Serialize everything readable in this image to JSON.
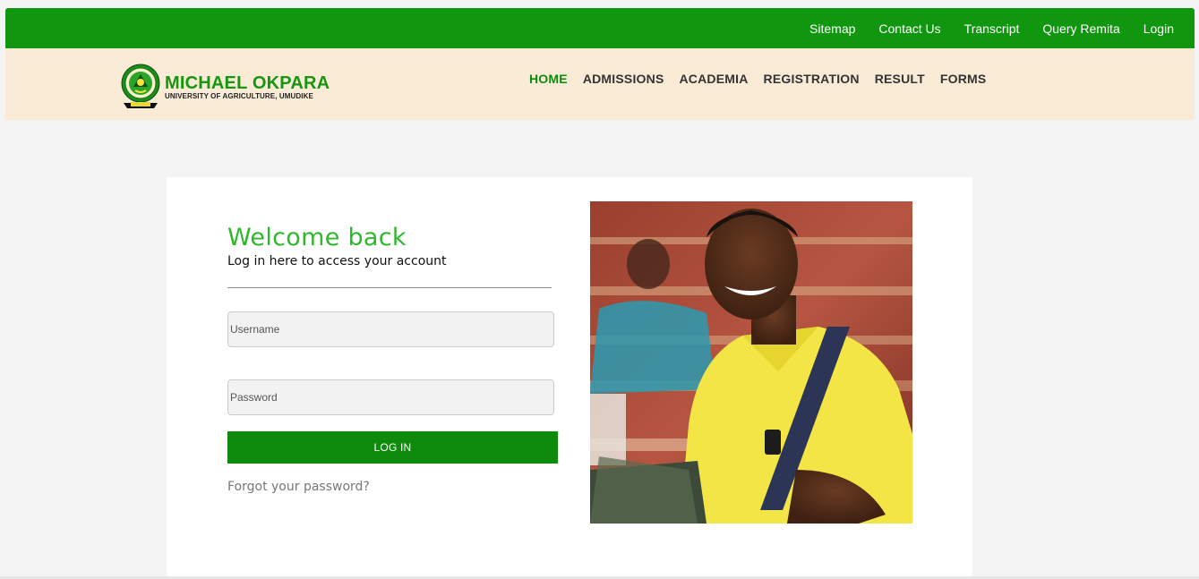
{
  "top_links": [
    "Sitemap",
    "Contact Us",
    "Transcript",
    "Query Remita",
    "Login"
  ],
  "brand": {
    "name": "MICHAEL OKPARA",
    "subtitle": "UNIVERSITY OF AGRICULTURE, UMUDIKE"
  },
  "nav": {
    "items": [
      "HOME",
      "ADMISSIONS",
      "ACADEMIA",
      "REGISTRATION",
      "RESULT",
      "FORMS"
    ],
    "active": "HOME"
  },
  "login": {
    "title": "Welcome back",
    "subtitle": "Log in here to access your account",
    "username_placeholder": "Username",
    "password_placeholder": "Password",
    "button_label": "LOG IN",
    "forgot_label": "Forgot your password?"
  },
  "colors": {
    "primary_green": "#11960f",
    "header_cream": "#faebd7",
    "title_green": "#2fb82c"
  },
  "icons": {
    "logo": "university-seal-icon"
  }
}
